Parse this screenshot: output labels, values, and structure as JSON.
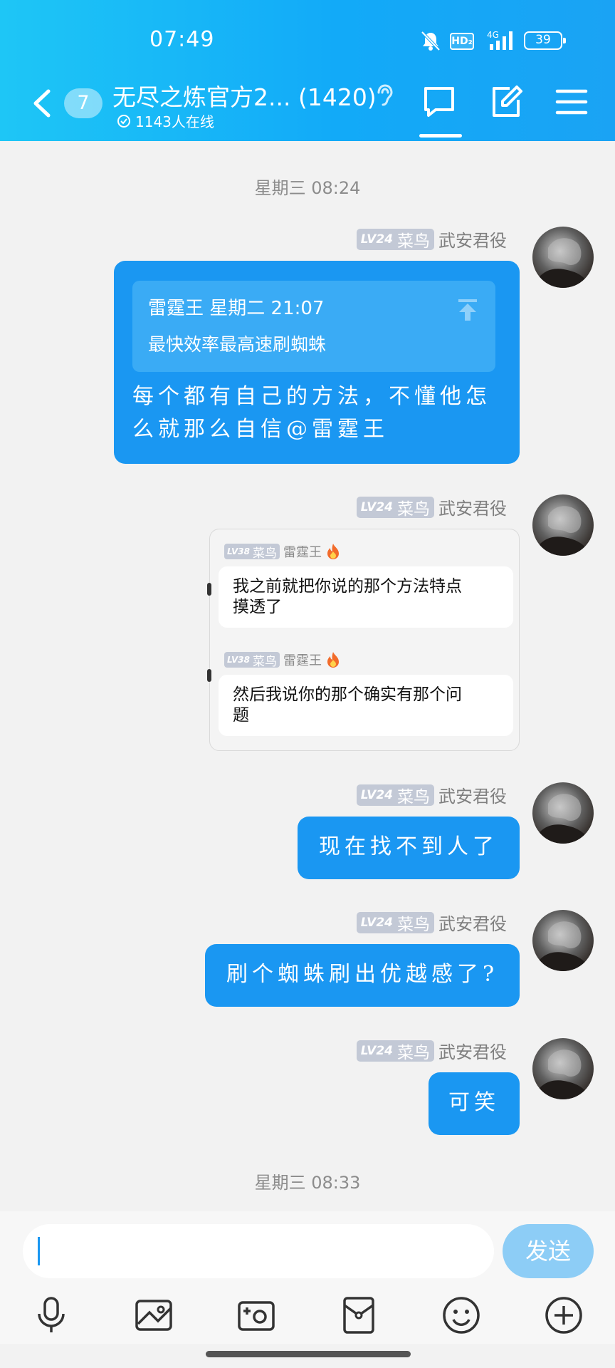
{
  "status_bar": {
    "time": "07:49",
    "hd_label": "HD₂",
    "network": "4G",
    "battery": "39"
  },
  "header": {
    "unread_count": "7",
    "title": "无尽之炼官方2... (1420)",
    "online": "1143人在线"
  },
  "chat": {
    "timestamps": [
      "星期三 08:24",
      "星期三 08:33"
    ],
    "me": {
      "level": "LV24",
      "rank": "菜鸟",
      "name": "武安君役"
    },
    "messages": [
      {
        "quote_sender_time": "雷霆王 星期二 21:07",
        "quote_text": "最快效率最高速刷蜘蛛",
        "lines": [
          "每个都有自己的方法，不懂他怎",
          "么就那么自信@雷霆王"
        ]
      },
      {
        "forward": [
          {
            "level": "LV38",
            "rank": "菜鸟",
            "name": "雷霆王",
            "lines": [
              "我之前就把你说的那个方法特点",
              "摸透了"
            ]
          },
          {
            "level": "LV38",
            "rank": "菜鸟",
            "name": "雷霆王",
            "lines": [
              "然后我说你的那个确实有那个问",
              "题"
            ]
          }
        ]
      },
      {
        "text": "现在找不到人了"
      },
      {
        "text": "刷个蜘蛛刷出优越感了?"
      },
      {
        "text": "可笑"
      }
    ]
  },
  "input": {
    "placeholder": "",
    "send_label": "发送"
  },
  "toolbar": [
    "mic-icon",
    "image-icon",
    "camera-icon",
    "red-packet-icon",
    "emoji-icon",
    "plus-icon"
  ],
  "colors": {
    "header": "#12aaf8",
    "bubble": "#1a97f2",
    "send_disabled": "#8dcdf6",
    "level_tag": "#c3c9d6"
  }
}
